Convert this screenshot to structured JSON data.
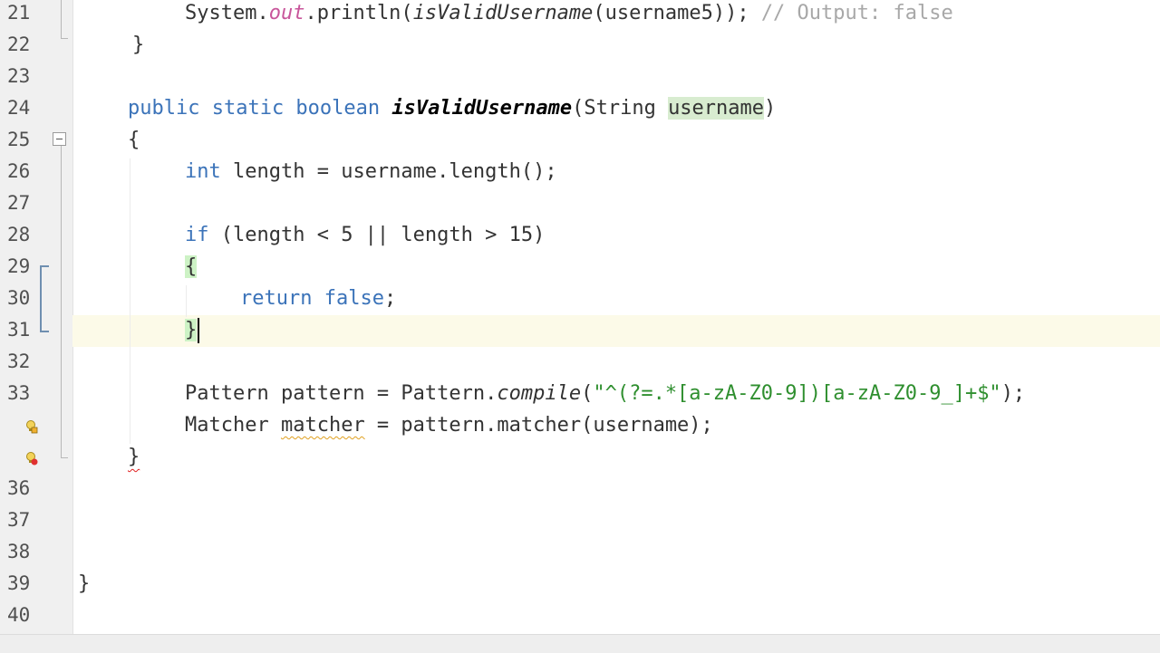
{
  "editor": {
    "lines": [
      {
        "number": "21",
        "tokens": [
          {
            "t": "System.",
            "c": ""
          },
          {
            "t": "out",
            "c": "fld"
          },
          {
            "t": ".println(",
            "c": ""
          },
          {
            "t": "isValidUsername",
            "c": "it"
          },
          {
            "t": "(username5)); ",
            "c": ""
          },
          {
            "t": "// Output: false",
            "c": "cmt"
          }
        ]
      },
      {
        "number": "22",
        "tokens": [
          {
            "t": "}",
            "c": ""
          }
        ]
      },
      {
        "number": "23",
        "tokens": []
      },
      {
        "number": "24",
        "tokens": [
          {
            "t": "public static boolean ",
            "c": "kw"
          },
          {
            "t": "isValidUsername",
            "c": "bi"
          },
          {
            "t": "(String ",
            "c": ""
          },
          {
            "t": "username",
            "c": "param-hl"
          },
          {
            "t": ")",
            "c": ""
          }
        ]
      },
      {
        "number": "25",
        "tokens": [
          {
            "t": "{",
            "c": ""
          }
        ]
      },
      {
        "number": "26",
        "tokens": [
          {
            "t": "int",
            "c": "kw"
          },
          {
            "t": " length = username.length();",
            "c": ""
          }
        ]
      },
      {
        "number": "27",
        "tokens": []
      },
      {
        "number": "28",
        "tokens": [
          {
            "t": "if",
            "c": "kw"
          },
          {
            "t": " (length < 5 || length > 15)",
            "c": ""
          }
        ]
      },
      {
        "number": "29",
        "tokens": [
          {
            "t": "{",
            "c": "brace-hl"
          }
        ]
      },
      {
        "number": "30",
        "tokens": [
          {
            "t": "return false",
            "c": "kw"
          },
          {
            "t": ";",
            "c": ""
          }
        ]
      },
      {
        "number": "31",
        "tokens": [
          {
            "t": "}",
            "c": "brace-hl"
          }
        ]
      },
      {
        "number": "32",
        "tokens": []
      },
      {
        "number": "33",
        "tokens": [
          {
            "t": "Pattern pattern = Pattern.",
            "c": ""
          },
          {
            "t": "compile",
            "c": "it"
          },
          {
            "t": "(",
            "c": ""
          },
          {
            "t": "\"^(?=.*[a-zA-Z0-9])[a-zA-Z0-9_]+$\"",
            "c": "str"
          },
          {
            "t": ");",
            "c": ""
          }
        ]
      },
      {
        "number": "",
        "tokens": [
          {
            "t": "Matcher ",
            "c": ""
          },
          {
            "t": "matcher",
            "c": "squiggle-y"
          },
          {
            "t": " = pattern.matcher(username);",
            "c": ""
          }
        ]
      },
      {
        "number": "",
        "tokens": [
          {
            "t": "}",
            "c": "squiggle-r"
          }
        ]
      },
      {
        "number": "36",
        "tokens": []
      },
      {
        "number": "37",
        "tokens": []
      },
      {
        "number": "38",
        "tokens": []
      },
      {
        "number": "39",
        "tokens": [
          {
            "t": "}",
            "c": ""
          }
        ]
      },
      {
        "number": "40",
        "tokens": []
      }
    ]
  },
  "colors": {
    "keyword": "#3b73b9",
    "string": "#2f8f2f",
    "comment": "#a8a8a8",
    "static_field": "#c8569b",
    "current_line": "#fcfae8",
    "gutter": "#f0f0f0"
  },
  "gutter_icons": [
    "warning-hint-icon",
    "error-hint-icon"
  ]
}
